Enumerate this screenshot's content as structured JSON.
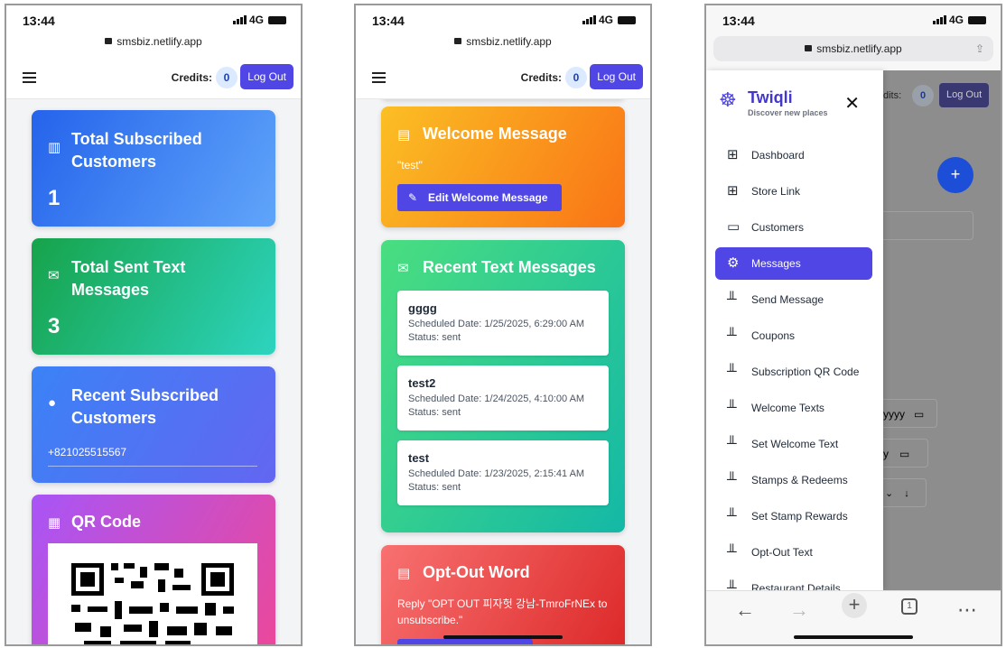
{
  "status": {
    "time": "13:44",
    "network": "4G"
  },
  "browser": {
    "url": "smsbiz.netlify.app"
  },
  "header": {
    "credits_label": "Credits:",
    "credits_value": "0",
    "logout_label": "Log Out"
  },
  "screen1": {
    "total_subscribed": {
      "title": "Total Subscribed Customers",
      "value": "1"
    },
    "total_sent": {
      "title": "Total Sent Text Messages",
      "value": "3"
    },
    "recent_subscribed": {
      "title": "Recent Subscribed Customers",
      "phone": "+821025515567"
    },
    "qr_title": "QR Code"
  },
  "screen2": {
    "welcome": {
      "title": "Welcome Message",
      "text": "\"test\"",
      "button": "Edit Welcome Message"
    },
    "recent": {
      "title": "Recent Text Messages",
      "messages": [
        {
          "title": "gggg",
          "date": "Scheduled Date: 1/25/2025, 6:29:00 AM",
          "status": "Status: sent"
        },
        {
          "title": "test2",
          "date": "Scheduled Date: 1/24/2025, 4:10:00 AM",
          "status": "Status: sent"
        },
        {
          "title": "test",
          "date": "Scheduled Date: 1/23/2025, 2:15:41 AM",
          "status": "Status: sent"
        }
      ]
    },
    "optout": {
      "title": "Opt-Out Word",
      "text": "Reply \"OPT OUT 피자헛 강남-TmroFrNEx to unsubscribe.\""
    }
  },
  "screen3": {
    "brand": {
      "name": "Twiqli",
      "tagline": "Discover new places"
    },
    "bg_fragments": {
      "credits": "dits:",
      "yyyy": "yyyy",
      "y": "y"
    },
    "nav": [
      {
        "label": "Dashboard",
        "icon": "grid-icon"
      },
      {
        "label": "Store Link",
        "icon": "grid-icon"
      },
      {
        "label": "Customers",
        "icon": "chat-icon"
      },
      {
        "label": "Messages",
        "icon": "gear-icon",
        "active": true
      },
      {
        "label": "Send Message",
        "icon": "bar-chart-icon"
      },
      {
        "label": "Coupons",
        "icon": "bar-chart-icon"
      },
      {
        "label": "Subscription QR Code",
        "icon": "bar-chart-icon"
      },
      {
        "label": "Welcome Texts",
        "icon": "bar-chart-icon"
      },
      {
        "label": "Set Welcome Text",
        "icon": "bar-chart-icon"
      },
      {
        "label": "Stamps & Redeems",
        "icon": "bar-chart-icon"
      },
      {
        "label": "Set Stamp Rewards",
        "icon": "bar-chart-icon"
      },
      {
        "label": "Opt-Out Text",
        "icon": "bar-chart-icon"
      },
      {
        "label": "Restaurant Details",
        "icon": "bar-chart-icon"
      }
    ],
    "tab_count": "1"
  },
  "colors": {
    "accent": "#4f46e5",
    "badge": "#dbeafe"
  }
}
